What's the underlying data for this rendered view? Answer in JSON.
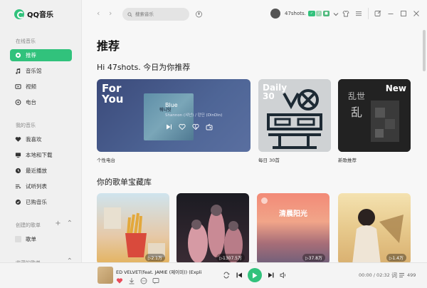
{
  "app": {
    "name": "QQ音乐",
    "accent": "#31c27c"
  },
  "sidebar": {
    "online_title": "在线音乐",
    "online_items": [
      {
        "label": "推荐",
        "icon": "recommend-icon",
        "active": true
      },
      {
        "label": "音乐馆",
        "icon": "music-note-icon"
      },
      {
        "label": "视频",
        "icon": "video-icon"
      },
      {
        "label": "电台",
        "icon": "radio-icon"
      }
    ],
    "mine_title": "我的音乐",
    "mine_items": [
      {
        "label": "我喜欢",
        "icon": "heart-icon"
      },
      {
        "label": "本地和下载",
        "icon": "monitor-icon"
      },
      {
        "label": "最近播放",
        "icon": "clock-icon"
      },
      {
        "label": "试听列表",
        "icon": "playlist-icon"
      },
      {
        "label": "已购音乐",
        "icon": "purchased-icon"
      }
    ],
    "created_title": "创建的歌单",
    "created_items": [
      {
        "label": "歌单"
      }
    ],
    "collected_title": "收藏的歌单"
  },
  "topbar": {
    "search_placeholder": "搜索音乐",
    "username": "47shots.",
    "badges": [
      "green",
      "vip",
      "gold"
    ]
  },
  "main": {
    "page_title": "推荐",
    "greeting": "Hi 47shots. 今日为你推荐",
    "cards": [
      {
        "tag": "For You",
        "song": "Blue",
        "artist": "Shannon (샤넌) / 던딘 (DinDin)",
        "cover_text": "뭐니잇",
        "caption": "个性电台"
      },
      {
        "tag": "Daily 30",
        "caption": "每日 30首"
      },
      {
        "tag": "New",
        "caption": "新歌推荐"
      }
    ],
    "library_title": "你的歌单宝藏库",
    "library": [
      {
        "count": "▷2.1万"
      },
      {
        "count": "▷1307.5万"
      },
      {
        "count": "▷37.8万",
        "text": "清晨阳光"
      },
      {
        "count": "▷1.4万"
      }
    ]
  },
  "player": {
    "title": "ED VELVET(feat. JAMIE (제이미)) (Explic",
    "time": "00:00 / 02:32",
    "playlist_count": "499"
  }
}
